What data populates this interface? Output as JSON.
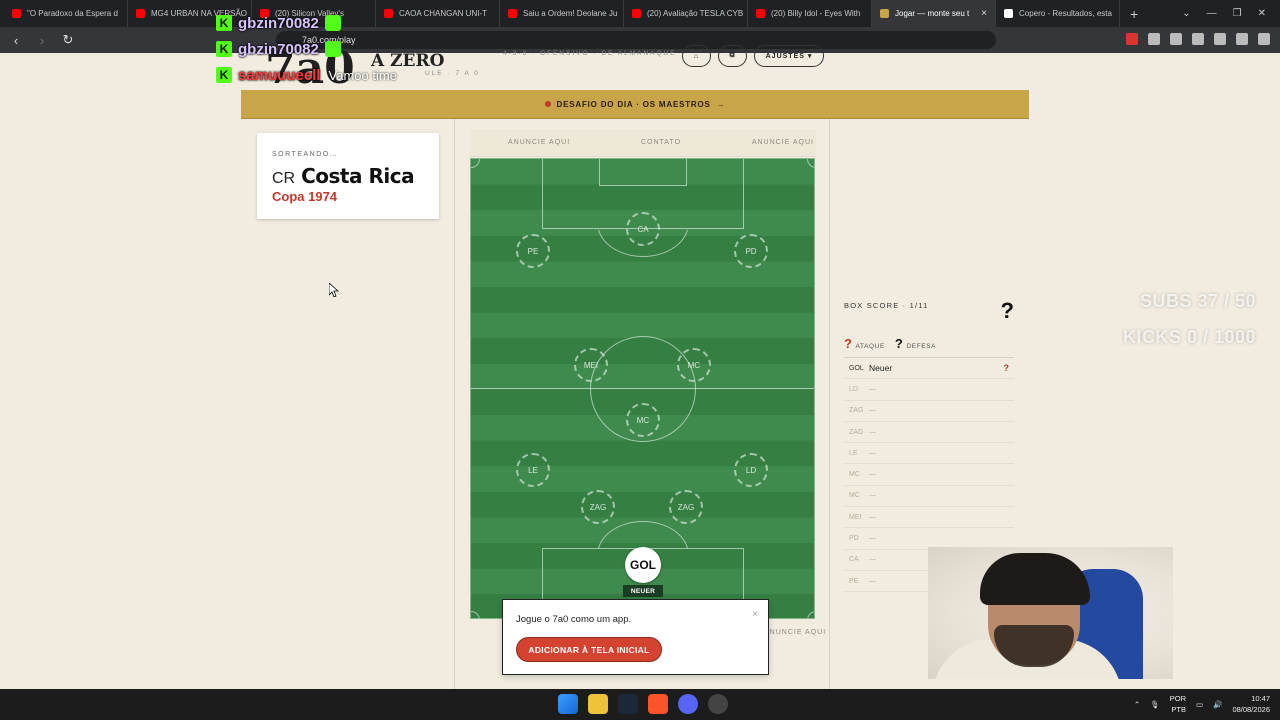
{
  "browser": {
    "tabs": [
      {
        "title": "\"O Paradoxo da Espera d",
        "color": "#ff0000"
      },
      {
        "title": "MG4 URBAN NA VERSÃO",
        "color": "#ff0000"
      },
      {
        "title": "(20) Silicon Valley's ",
        "color": "#ff0000"
      },
      {
        "title": "CAOA CHANGAN UNI-T",
        "color": "#ff0000"
      },
      {
        "title": "Saiu a Ordem! Deolane Ju",
        "color": "#ff0000"
      },
      {
        "title": "(20) Avaliação TESLA CYB",
        "color": "#ff0000"
      },
      {
        "title": "(20) Billy Idol - Eyes With",
        "color": "#ff0000"
      },
      {
        "title": "Jogar — monte seu t",
        "color": "#c9a54a",
        "active": true
      },
      {
        "title": "Copero - Resultados, esta",
        "color": "#ffffff"
      }
    ],
    "new_tab": "+",
    "url": "7a0.com/play"
  },
  "chat": {
    "rows": [
      {
        "user": "gbzin70082",
        "badge": "K",
        "message": ""
      },
      {
        "user": "gbzin70082",
        "badge": "K",
        "message": ""
      },
      {
        "user": "samuuueell",
        "badge": "K",
        "message": "Vamoo time"
      }
    ]
  },
  "header": {
    "logo": "7a0",
    "wordmark": "A ZERO",
    "tagline": "4-3-3 · OFENSIVO · DE ALMANAQUE",
    "tagline2": "ULE · 7 A 0",
    "settings_label": "AJUSTES ▾"
  },
  "challenge": {
    "label": "DESAFIO DO DIA · OS MAESTROS",
    "arrow": "→"
  },
  "draw": {
    "label": "SORTEANDO…",
    "code": "CR",
    "team": "Costa Rica",
    "cup": "Copa 1974"
  },
  "ads": {
    "left": "ANUNCIE AQUI",
    "center": "CONTATO",
    "right": "ANUNCIE AQUI",
    "bottom": "ANUNCIE AQUI"
  },
  "pitch": {
    "positions": [
      "CA",
      "PE",
      "PD",
      "MEI",
      "MC",
      "MC",
      "LE",
      "LD",
      "ZAG",
      "ZAG"
    ],
    "goalkeeper": {
      "label": "GOL",
      "player": "NEUER"
    }
  },
  "popup": {
    "text": "Jogue o 7a0 como um app.",
    "button": "ADICIONAR À TELA INICIAL",
    "close": "×"
  },
  "boxscore": {
    "title": "BOX SCORE · 1/11",
    "mystery": "?",
    "legend": [
      {
        "icon": "?",
        "label": "ATAQUE",
        "color": "#c0392b"
      },
      {
        "icon": "?",
        "label": "DEFESA",
        "color": "#111111"
      }
    ],
    "rows": [
      {
        "pos": "GOL",
        "player": "Neuer",
        "rating": "?"
      },
      {
        "pos": "LD",
        "player": "—",
        "rating": ""
      },
      {
        "pos": "ZAG",
        "player": "—",
        "rating": ""
      },
      {
        "pos": "ZAG",
        "player": "—",
        "rating": ""
      },
      {
        "pos": "LE",
        "player": "—",
        "rating": ""
      },
      {
        "pos": "MC",
        "player": "—",
        "rating": ""
      },
      {
        "pos": "MC",
        "player": "—",
        "rating": ""
      },
      {
        "pos": "MEI",
        "player": "—",
        "rating": ""
      },
      {
        "pos": "PD",
        "player": "—",
        "rating": ""
      },
      {
        "pos": "CA",
        "player": "—",
        "rating": ""
      },
      {
        "pos": "PE",
        "player": "—",
        "rating": ""
      }
    ]
  },
  "stream_stats": {
    "subs": "SUBS 37 / 50",
    "kicks": "KICKS 0 / 1000"
  },
  "taskbar": {
    "lang": "POR",
    "layout": "PTB",
    "time": "10:47",
    "date": "08/08/2026"
  }
}
